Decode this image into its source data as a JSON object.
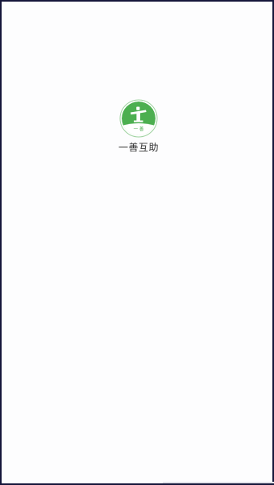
{
  "app": {
    "name": "一善互助",
    "logo_icon": "yishan-logo-icon",
    "logo_mark_text": "一 善",
    "brand_color": "#4caf50"
  },
  "screen": {
    "background": "#fdfdfe",
    "frame_color": "#15163a"
  }
}
